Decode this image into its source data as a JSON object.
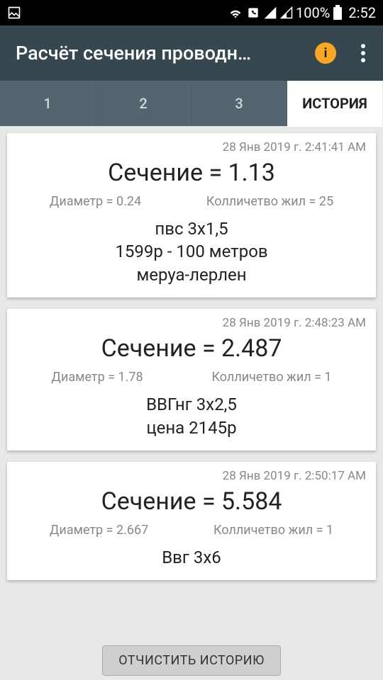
{
  "status": {
    "time": "2:52",
    "battery": "100%"
  },
  "appbar": {
    "title": "Расчёт сечения проводн…"
  },
  "tabs": {
    "items": [
      {
        "label": "1"
      },
      {
        "label": "2"
      },
      {
        "label": "3"
      },
      {
        "label": "ИСТОРИЯ"
      }
    ]
  },
  "history": [
    {
      "timestamp": "28 Янв 2019 г. 2:41:41 AM",
      "section": "Сечение = 1.13",
      "diameter": "Диаметр = 0.24",
      "cores": "Колличетво жил = 25",
      "note_lines": [
        "пвс 3x1,5",
        "1599р - 100 метров",
        "меруа-лерлен"
      ]
    },
    {
      "timestamp": "28 Янв 2019 г. 2:48:23 AM",
      "section": "Сечение = 2.487",
      "diameter": "Диаметр = 1.78",
      "cores": "Колличетво жил = 1",
      "note_lines": [
        "ВВГнг 3x2,5",
        "цена 2145р"
      ]
    },
    {
      "timestamp": "28 Янв 2019 г. 2:50:17 AM",
      "section": "Сечение = 5.584",
      "diameter": "Диаметр = 2.667",
      "cores": "Колличетво жил = 1",
      "note_lines": [
        "Ввг 3x6"
      ]
    }
  ],
  "buttons": {
    "clear": "ОТЧИСТИТЬ ИСТОРИЮ"
  }
}
